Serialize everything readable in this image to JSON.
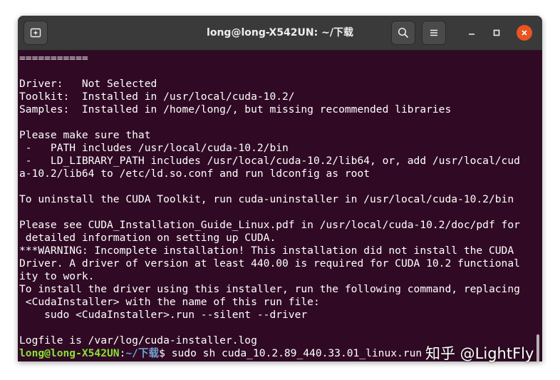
{
  "window": {
    "title": "long@long-X542UN: ~/下载"
  },
  "titlebar": {
    "icons": [
      "new-tab-icon",
      "search-icon",
      "menu-icon",
      "minimize-icon",
      "maximize-icon",
      "close-icon"
    ]
  },
  "colors": {
    "terminal_bg": "#300a24",
    "titlebar_bg": "#3a3a3a",
    "close_button": "#e95420",
    "prompt_user": "#8ae234",
    "prompt_path": "#729fcf",
    "text": "#ffffff"
  },
  "terminal": {
    "lines": [
      "===========",
      "",
      "Driver:   Not Selected",
      "Toolkit:  Installed in /usr/local/cuda-10.2/",
      "Samples:  Installed in /home/long/, but missing recommended libraries",
      "",
      "Please make sure that",
      " -   PATH includes /usr/local/cuda-10.2/bin",
      " -   LD_LIBRARY_PATH includes /usr/local/cuda-10.2/lib64, or, add /usr/local/cud",
      "a-10.2/lib64 to /etc/ld.so.conf and run ldconfig as root",
      "",
      "To uninstall the CUDA Toolkit, run cuda-uninstaller in /usr/local/cuda-10.2/bin",
      "",
      "Please see CUDA_Installation_Guide_Linux.pdf in /usr/local/cuda-10.2/doc/pdf for",
      " detailed information on setting up CUDA.",
      "***WARNING: Incomplete installation! This installation did not install the CUDA",
      "Driver. A driver of version at least 440.00 is required for CUDA 10.2 functional",
      "ity to work.",
      "To install the driver using this installer, run the following command, replacing",
      " <CudaInstaller> with the name of this run file:",
      "    sudo <CudaInstaller>.run --silent --driver",
      "",
      "Logfile is /var/log/cuda-installer.log"
    ],
    "prompt": {
      "user_host": "long@long-X542UN",
      "separator": ":",
      "path": "~/下载",
      "symbol": "$ ",
      "command": "sudo sh cuda_10.2.89_440.33.01_linux.run"
    }
  },
  "watermark": {
    "text": "知乎 @LightFly"
  }
}
